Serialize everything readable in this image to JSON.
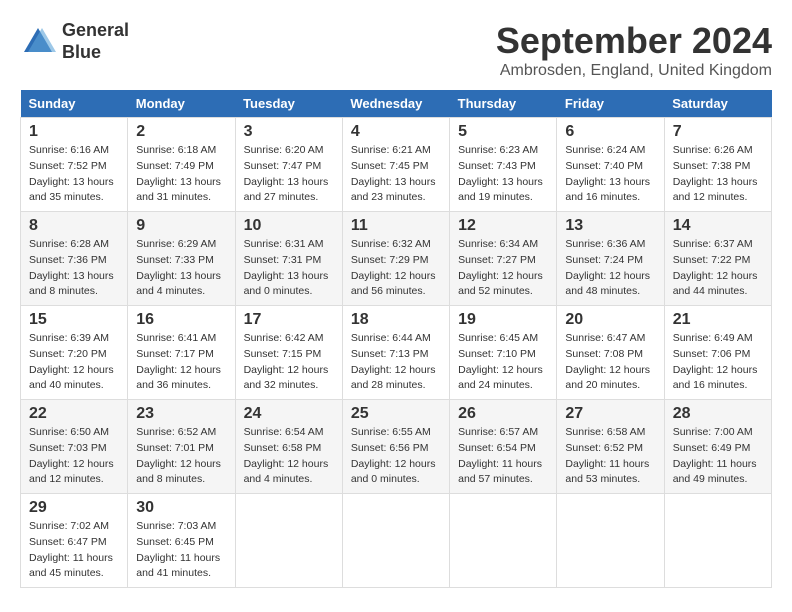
{
  "logo": {
    "line1": "General",
    "line2": "Blue"
  },
  "title": "September 2024",
  "location": "Ambrosden, England, United Kingdom",
  "days_of_week": [
    "Sunday",
    "Monday",
    "Tuesday",
    "Wednesday",
    "Thursday",
    "Friday",
    "Saturday"
  ],
  "weeks": [
    [
      {
        "day": "1",
        "sunrise": "6:16 AM",
        "sunset": "7:52 PM",
        "daylight": "13 hours and 35 minutes."
      },
      {
        "day": "2",
        "sunrise": "6:18 AM",
        "sunset": "7:49 PM",
        "daylight": "13 hours and 31 minutes."
      },
      {
        "day": "3",
        "sunrise": "6:20 AM",
        "sunset": "7:47 PM",
        "daylight": "13 hours and 27 minutes."
      },
      {
        "day": "4",
        "sunrise": "6:21 AM",
        "sunset": "7:45 PM",
        "daylight": "13 hours and 23 minutes."
      },
      {
        "day": "5",
        "sunrise": "6:23 AM",
        "sunset": "7:43 PM",
        "daylight": "13 hours and 19 minutes."
      },
      {
        "day": "6",
        "sunrise": "6:24 AM",
        "sunset": "7:40 PM",
        "daylight": "13 hours and 16 minutes."
      },
      {
        "day": "7",
        "sunrise": "6:26 AM",
        "sunset": "7:38 PM",
        "daylight": "13 hours and 12 minutes."
      }
    ],
    [
      {
        "day": "8",
        "sunrise": "6:28 AM",
        "sunset": "7:36 PM",
        "daylight": "13 hours and 8 minutes."
      },
      {
        "day": "9",
        "sunrise": "6:29 AM",
        "sunset": "7:33 PM",
        "daylight": "13 hours and 4 minutes."
      },
      {
        "day": "10",
        "sunrise": "6:31 AM",
        "sunset": "7:31 PM",
        "daylight": "13 hours and 0 minutes."
      },
      {
        "day": "11",
        "sunrise": "6:32 AM",
        "sunset": "7:29 PM",
        "daylight": "12 hours and 56 minutes."
      },
      {
        "day": "12",
        "sunrise": "6:34 AM",
        "sunset": "7:27 PM",
        "daylight": "12 hours and 52 minutes."
      },
      {
        "day": "13",
        "sunrise": "6:36 AM",
        "sunset": "7:24 PM",
        "daylight": "12 hours and 48 minutes."
      },
      {
        "day": "14",
        "sunrise": "6:37 AM",
        "sunset": "7:22 PM",
        "daylight": "12 hours and 44 minutes."
      }
    ],
    [
      {
        "day": "15",
        "sunrise": "6:39 AM",
        "sunset": "7:20 PM",
        "daylight": "12 hours and 40 minutes."
      },
      {
        "day": "16",
        "sunrise": "6:41 AM",
        "sunset": "7:17 PM",
        "daylight": "12 hours and 36 minutes."
      },
      {
        "day": "17",
        "sunrise": "6:42 AM",
        "sunset": "7:15 PM",
        "daylight": "12 hours and 32 minutes."
      },
      {
        "day": "18",
        "sunrise": "6:44 AM",
        "sunset": "7:13 PM",
        "daylight": "12 hours and 28 minutes."
      },
      {
        "day": "19",
        "sunrise": "6:45 AM",
        "sunset": "7:10 PM",
        "daylight": "12 hours and 24 minutes."
      },
      {
        "day": "20",
        "sunrise": "6:47 AM",
        "sunset": "7:08 PM",
        "daylight": "12 hours and 20 minutes."
      },
      {
        "day": "21",
        "sunrise": "6:49 AM",
        "sunset": "7:06 PM",
        "daylight": "12 hours and 16 minutes."
      }
    ],
    [
      {
        "day": "22",
        "sunrise": "6:50 AM",
        "sunset": "7:03 PM",
        "daylight": "12 hours and 12 minutes."
      },
      {
        "day": "23",
        "sunrise": "6:52 AM",
        "sunset": "7:01 PM",
        "daylight": "12 hours and 8 minutes."
      },
      {
        "day": "24",
        "sunrise": "6:54 AM",
        "sunset": "6:58 PM",
        "daylight": "12 hours and 4 minutes."
      },
      {
        "day": "25",
        "sunrise": "6:55 AM",
        "sunset": "6:56 PM",
        "daylight": "12 hours and 0 minutes."
      },
      {
        "day": "26",
        "sunrise": "6:57 AM",
        "sunset": "6:54 PM",
        "daylight": "11 hours and 57 minutes."
      },
      {
        "day": "27",
        "sunrise": "6:58 AM",
        "sunset": "6:52 PM",
        "daylight": "11 hours and 53 minutes."
      },
      {
        "day": "28",
        "sunrise": "7:00 AM",
        "sunset": "6:49 PM",
        "daylight": "11 hours and 49 minutes."
      }
    ],
    [
      {
        "day": "29",
        "sunrise": "7:02 AM",
        "sunset": "6:47 PM",
        "daylight": "11 hours and 45 minutes."
      },
      {
        "day": "30",
        "sunrise": "7:03 AM",
        "sunset": "6:45 PM",
        "daylight": "11 hours and 41 minutes."
      },
      null,
      null,
      null,
      null,
      null
    ]
  ],
  "labels": {
    "sunrise": "Sunrise:",
    "sunset": "Sunset:",
    "daylight": "Daylight:"
  }
}
